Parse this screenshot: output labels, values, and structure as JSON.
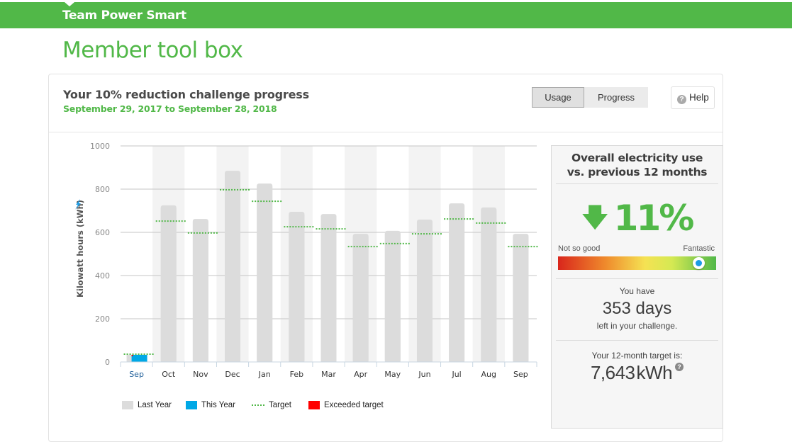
{
  "topbar": {
    "brand": "Team Power Smart"
  },
  "page_title": "Member tool box",
  "card": {
    "title": "Your 10% reduction challenge progress",
    "date_range": "September 29, 2017 to September 28, 2018",
    "toggle": {
      "usage_label": "Usage",
      "progress_label": "Progress",
      "selected": "Usage"
    },
    "help_label": "Help"
  },
  "colors": {
    "brand_green": "#51b848",
    "last_year": "#dcdcdc",
    "this_year": "#00a8e6",
    "target": "#51b848",
    "exceeded": "#ff0000"
  },
  "chart_data": {
    "type": "bar",
    "title": "",
    "xlabel": "",
    "ylabel": "Kilowatt hours (kWh)",
    "ylim": [
      0,
      1000
    ],
    "yticks": [
      0,
      200,
      400,
      600,
      800,
      1000
    ],
    "grid": true,
    "categories": [
      "Sep",
      "Oct",
      "Nov",
      "Dec",
      "Jan",
      "Feb",
      "Mar",
      "Apr",
      "May",
      "Jun",
      "Jul",
      "Aug",
      "Sep"
    ],
    "current_index": 0,
    "series": [
      {
        "name": "Last Year",
        "values": [
          33,
          725,
          662,
          885,
          826,
          695,
          685,
          593,
          607,
          659,
          734,
          715,
          593
        ]
      },
      {
        "name": "This Year",
        "values": [
          33,
          null,
          null,
          null,
          null,
          null,
          null,
          null,
          null,
          null,
          null,
          null,
          null
        ]
      },
      {
        "name": "Target",
        "values": [
          36,
          652,
          597,
          797,
          744,
          626,
          616,
          534,
          548,
          593,
          662,
          643,
          534
        ]
      }
    ],
    "legend": [
      "Last Year",
      "This Year",
      "Target",
      "Exceeded target"
    ],
    "legend_position": "bottom"
  },
  "side": {
    "heading_line1": "Overall electricity use",
    "heading_line2": "vs. previous 12 months",
    "change_direction": "down",
    "change_value": "11",
    "change_unit": "%",
    "gauge_left_label": "Not so good",
    "gauge_right_label": "Fantastic",
    "gauge_level": 0.89,
    "days_prefix": "You have",
    "days_value": "353 days",
    "days_suffix": "left in your challenge.",
    "target_label": "Your 12-month target is:",
    "target_value": "7,643",
    "target_unit": "kWh"
  }
}
